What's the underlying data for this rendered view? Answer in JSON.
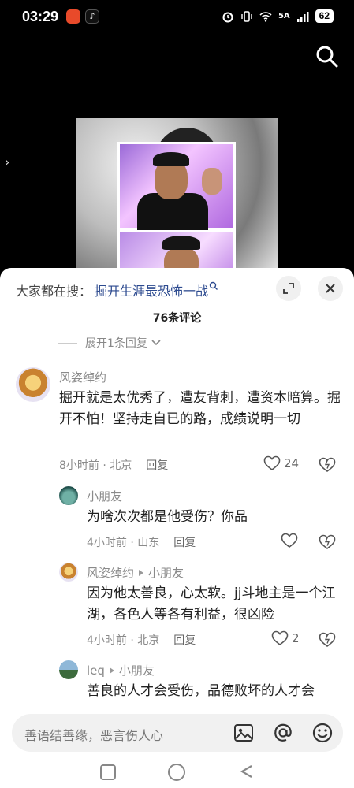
{
  "status_bar": {
    "time": "03:29",
    "network": "5A",
    "battery": "62"
  },
  "search_bar": {
    "prefix": "大家都在搜：",
    "keyword": "掘开生涯最恐怖一战"
  },
  "comments_count": "76条评论",
  "expand_replies": "展开1条回复",
  "comments": [
    {
      "author": "风姿绰约",
      "text": "掘开就是太优秀了，遭友背刺，遭资本暗算。掘开不怕！坚持走自已的路，成绩说明一切",
      "time": "8小时前",
      "location": "北京",
      "reply_label": "回复",
      "likes": "24"
    },
    {
      "author": "小朋友",
      "text": "为啥次次都是他受伤？你品",
      "time": "4小时前",
      "location": "山东",
      "reply_label": "回复",
      "likes": ""
    },
    {
      "author": "风姿绰约",
      "reply_to": "小朋友",
      "text": "因为他太善良，心太软。jj斗地主是一个江湖，各色人等各有利益，很凶险",
      "time": "4小时前",
      "location": "北京",
      "reply_label": "回复",
      "likes": "2"
    },
    {
      "author": "leq",
      "reply_to": "小朋友",
      "text": "善良的人才会受伤，品德败坏的人才会"
    }
  ],
  "input": {
    "placeholder": "善语结善缘，恶言伤人心"
  },
  "colors": {
    "keyword": "#2c4a8f",
    "panel_bg": "#ffffff",
    "meta": "#8a8a8a"
  },
  "icons": [
    "search-icon",
    "expand-icon",
    "close-icon",
    "heart-icon",
    "dislike-icon",
    "image-icon",
    "at-icon",
    "emoji-icon"
  ]
}
